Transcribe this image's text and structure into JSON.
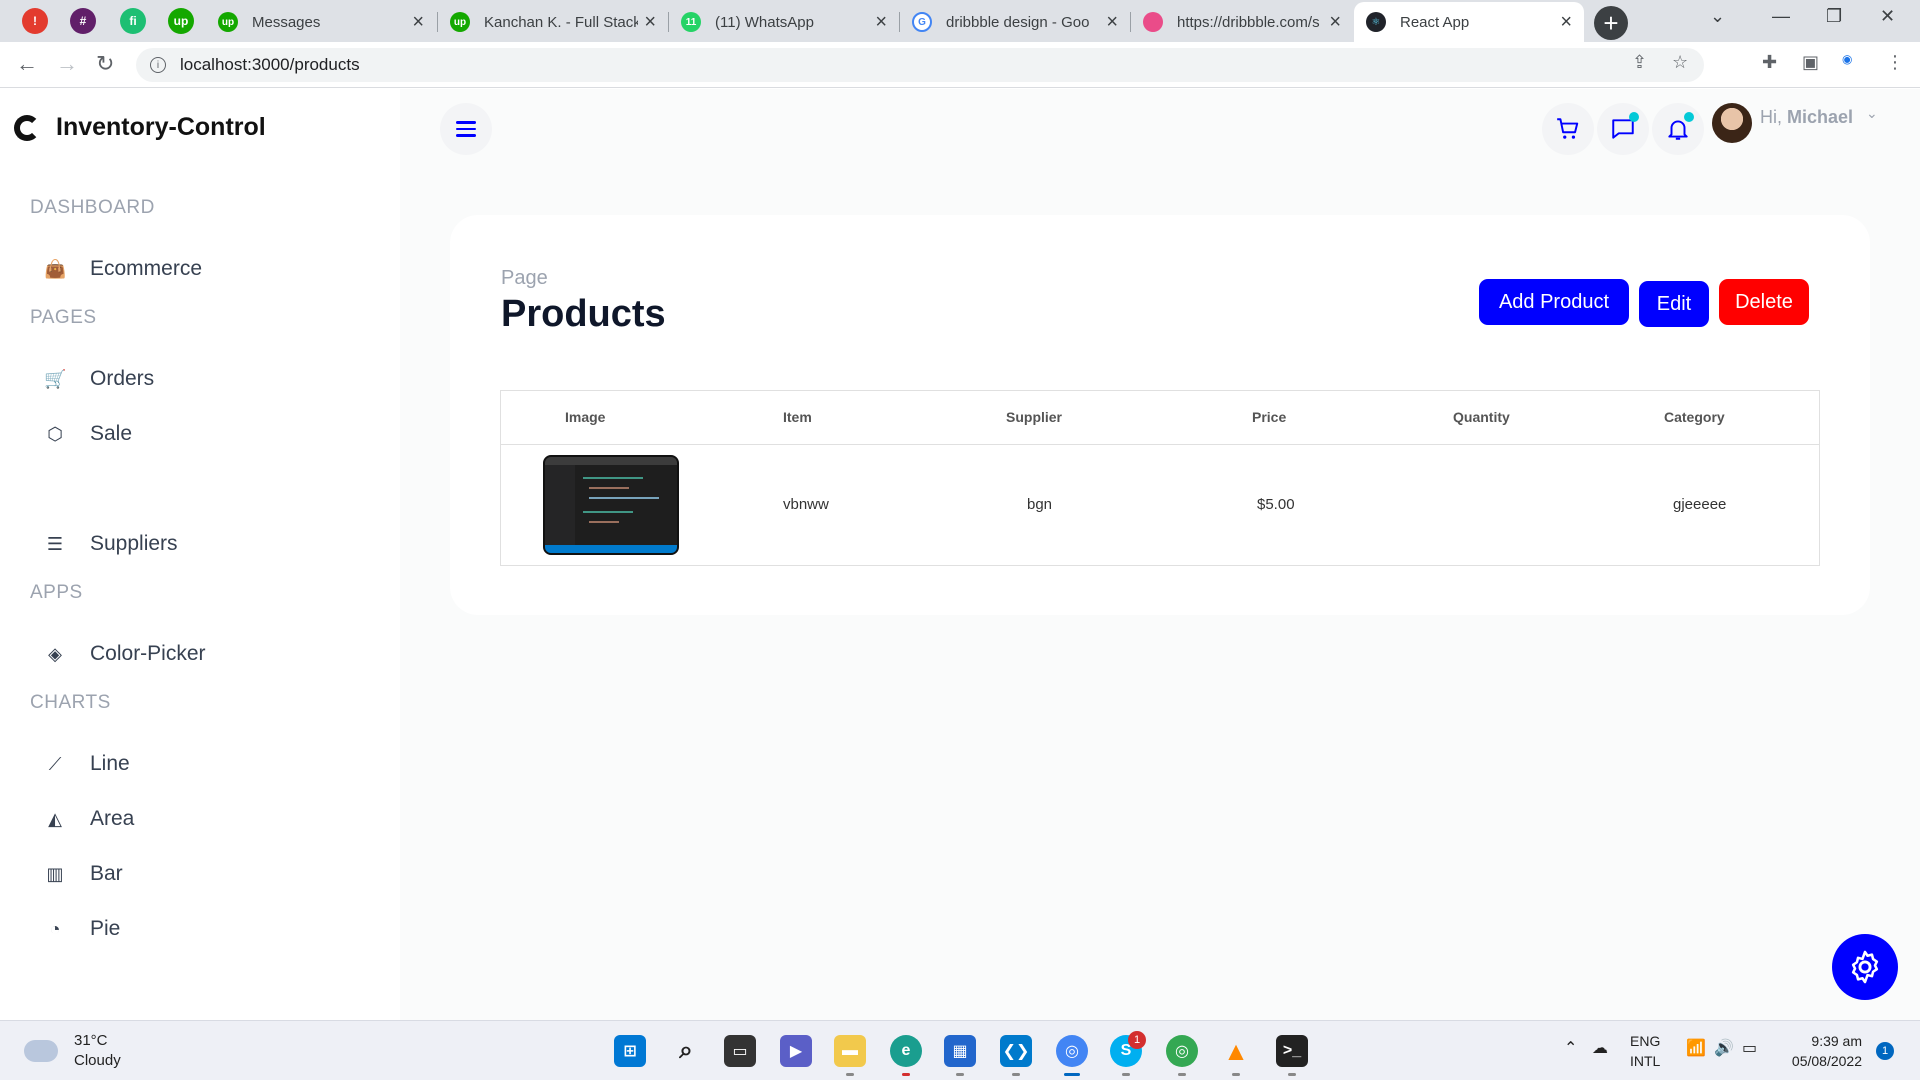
{
  "browser": {
    "pinned_tabs": [
      {
        "icon": "alert-icon",
        "color": "#e33b2e"
      },
      {
        "icon": "slack-icon",
        "color": "#611f69"
      },
      {
        "icon": "fiverr-icon",
        "color": "#1dbf73"
      },
      {
        "icon": "upwork-icon",
        "color": "#14a800"
      }
    ],
    "tabs": [
      {
        "label": "Messages",
        "icon": "upwork-icon",
        "color": "#14a800"
      },
      {
        "label": "Kanchan K. - Full Stack",
        "icon": "upwork-icon",
        "color": "#14a800"
      },
      {
        "label": "(11) WhatsApp",
        "icon": "whatsapp-icon",
        "color": "#25d366"
      },
      {
        "label": "dribbble design - Goo",
        "icon": "google-icon",
        "color": "#4285f4"
      },
      {
        "label": "https://dribbble.com/s",
        "icon": "dribbble-icon",
        "color": "#ea4c89"
      },
      {
        "label": "React App",
        "icon": "react-icon",
        "color": "#20232a",
        "active": true
      }
    ],
    "url": "localhost:3000/products"
  },
  "sidebar": {
    "brand": "Inventory-Control",
    "sections": [
      {
        "title": "DASHBOARD",
        "items": [
          {
            "label": "Ecommerce",
            "icon": "shopping-bag-icon"
          }
        ]
      },
      {
        "title": "PAGES",
        "items": [
          {
            "label": "Orders",
            "icon": "cart-icon"
          },
          {
            "label": "Sale",
            "icon": "box-icon"
          },
          {
            "label": "Suppliers",
            "icon": "people-icon"
          }
        ]
      },
      {
        "title": "APPS",
        "items": [
          {
            "label": "Color-Picker",
            "icon": "paint-bucket-icon"
          }
        ]
      },
      {
        "title": "CHARTS",
        "items": [
          {
            "label": "Line",
            "icon": "line-chart-icon"
          },
          {
            "label": "Area",
            "icon": "area-chart-icon"
          },
          {
            "label": "Bar",
            "icon": "bar-chart-icon"
          },
          {
            "label": "Pie",
            "icon": "pie-chart-icon"
          }
        ]
      }
    ]
  },
  "navbar": {
    "greeting_prefix": "Hi,",
    "user_name": "Michael",
    "accent_color": "#0000ff",
    "notification_dot_color": "#03c9d7"
  },
  "page": {
    "breadcrumb": "Page",
    "title": "Products",
    "buttons": {
      "add": "Add Product",
      "edit": "Edit",
      "delete": "Delete"
    },
    "table": {
      "columns": [
        "Image",
        "Item",
        "Supplier",
        "Price",
        "Quantity",
        "Category"
      ],
      "rows": [
        {
          "image": "code-editor-screenshot",
          "item": "vbnww",
          "supplier": "bgn",
          "price": "$5.00",
          "quantity": "",
          "category": "gjeeeee"
        }
      ]
    }
  },
  "taskbar": {
    "weather": {
      "temp": "31°C",
      "condition": "Cloudy"
    },
    "language": {
      "lang": "ENG",
      "layout": "INTL"
    },
    "clock": {
      "time": "9:39 am",
      "date": "05/08/2022"
    },
    "skype_badge": "1",
    "notification_count": "1"
  }
}
